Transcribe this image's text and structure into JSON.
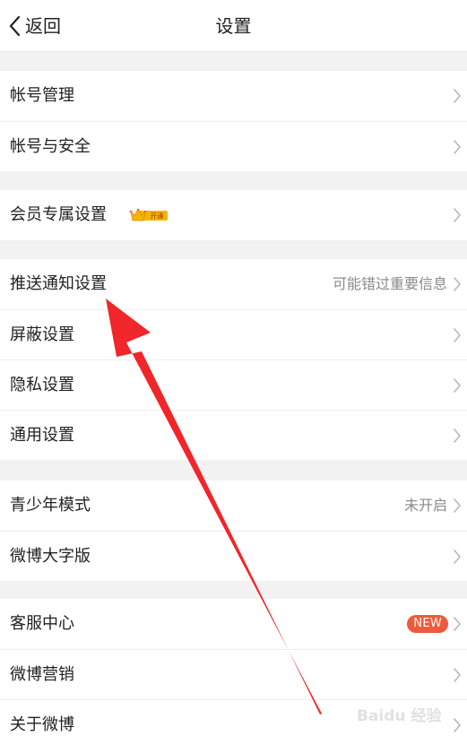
{
  "header": {
    "back_label": "返回",
    "title": "设置"
  },
  "sections": [
    {
      "rows": [
        {
          "label": "帐号管理"
        },
        {
          "label": "帐号与安全"
        }
      ]
    },
    {
      "rows": [
        {
          "label": "会员专属设置",
          "badge_text": "开通"
        }
      ]
    },
    {
      "rows": [
        {
          "label": "推送通知设置",
          "value": "可能错过重要信息"
        },
        {
          "label": "屏蔽设置"
        },
        {
          "label": "隐私设置"
        },
        {
          "label": "通用设置"
        }
      ]
    },
    {
      "rows": [
        {
          "label": "青少年模式",
          "value": "未开启"
        },
        {
          "label": "微博大字版"
        }
      ]
    },
    {
      "rows": [
        {
          "label": "客服中心",
          "badge": "NEW"
        },
        {
          "label": "微博营销"
        },
        {
          "label": "关于微博"
        }
      ]
    }
  ],
  "watermark": "Baidu 经验",
  "colors": {
    "background": "#f2f2f2",
    "row_background": "#ffffff",
    "chevron": "#b8b8b8",
    "secondary_text": "#8a8a8a",
    "new_badge": "#ee5a3b",
    "vip_badge": "#f5b400",
    "annotation_arrow": "#f0262a"
  },
  "icons": {
    "back": "chevron-left-icon",
    "row_arrow": "chevron-right-icon",
    "vip": "vip-crown-icon"
  }
}
